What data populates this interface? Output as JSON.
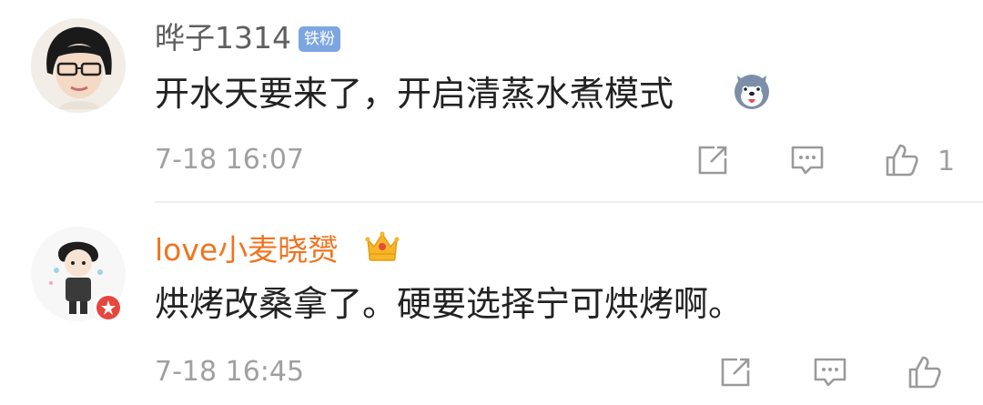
{
  "comments": [
    {
      "username": "晔子1314",
      "badge": "铁粉",
      "text": "开水天要来了，开启清蒸水煮模式",
      "emoji": "husky-dog-emoji",
      "timestamp": "7-18 16:07",
      "likes": "1",
      "name_color": "#5f5f5f"
    },
    {
      "username": "love小麦晓赟",
      "badge_icon": "crown-icon",
      "text": "烘烤改桑拿了。硬要选择宁可烘烤啊。",
      "timestamp": "7-18 16:45",
      "name_color": "#f0731f"
    }
  ],
  "icons": {
    "share": "share-icon",
    "reply": "comment-icon",
    "like": "thumbs-up-icon"
  },
  "colors": {
    "text": "#222222",
    "meta": "#a0a0a0",
    "badge": "#7da6e0",
    "vip_name": "#f0731f",
    "divider": "#eeeeee"
  }
}
